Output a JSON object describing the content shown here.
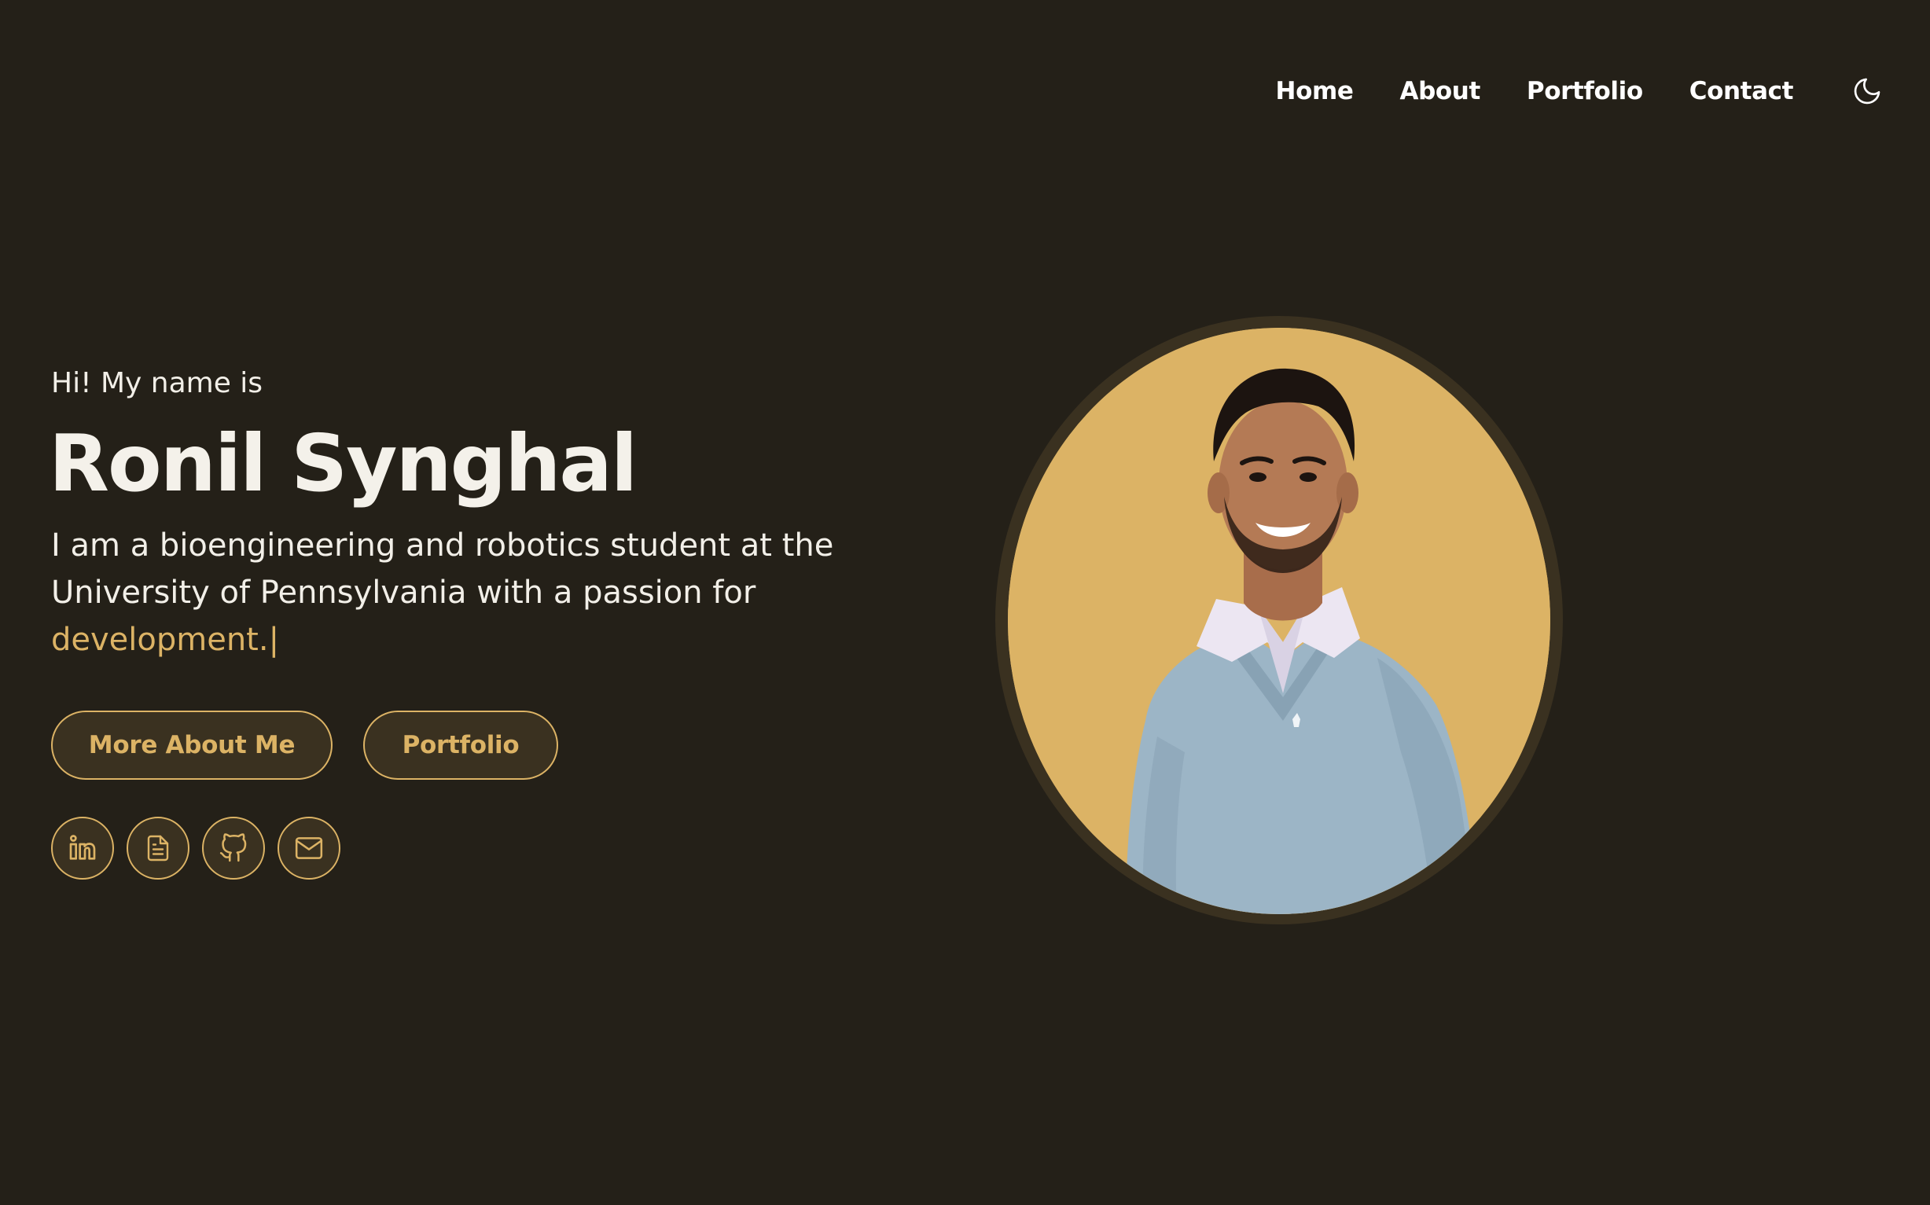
{
  "nav": {
    "items": [
      "Home",
      "About",
      "Portfolio",
      "Contact"
    ],
    "theme_toggle_icon": "moon-icon"
  },
  "hero": {
    "greeting": "Hi! My name is",
    "name": "Ronil Synghal",
    "tagline_static": "I am a bioengineering and robotics student at the University of Pennsylvania with a passion for",
    "tagline_typed": "development.",
    "caret": "|",
    "buttons": {
      "about": "More About Me",
      "portfolio": "Portfolio"
    },
    "social_icons": [
      "linkedin-icon",
      "resume-icon",
      "github-icon",
      "email-icon"
    ],
    "portrait_icon": "profile-photo"
  },
  "colors": {
    "background": "#242018",
    "accent": "#dcb365",
    "button_fill": "#3a3120",
    "text": "#f2efe8"
  }
}
